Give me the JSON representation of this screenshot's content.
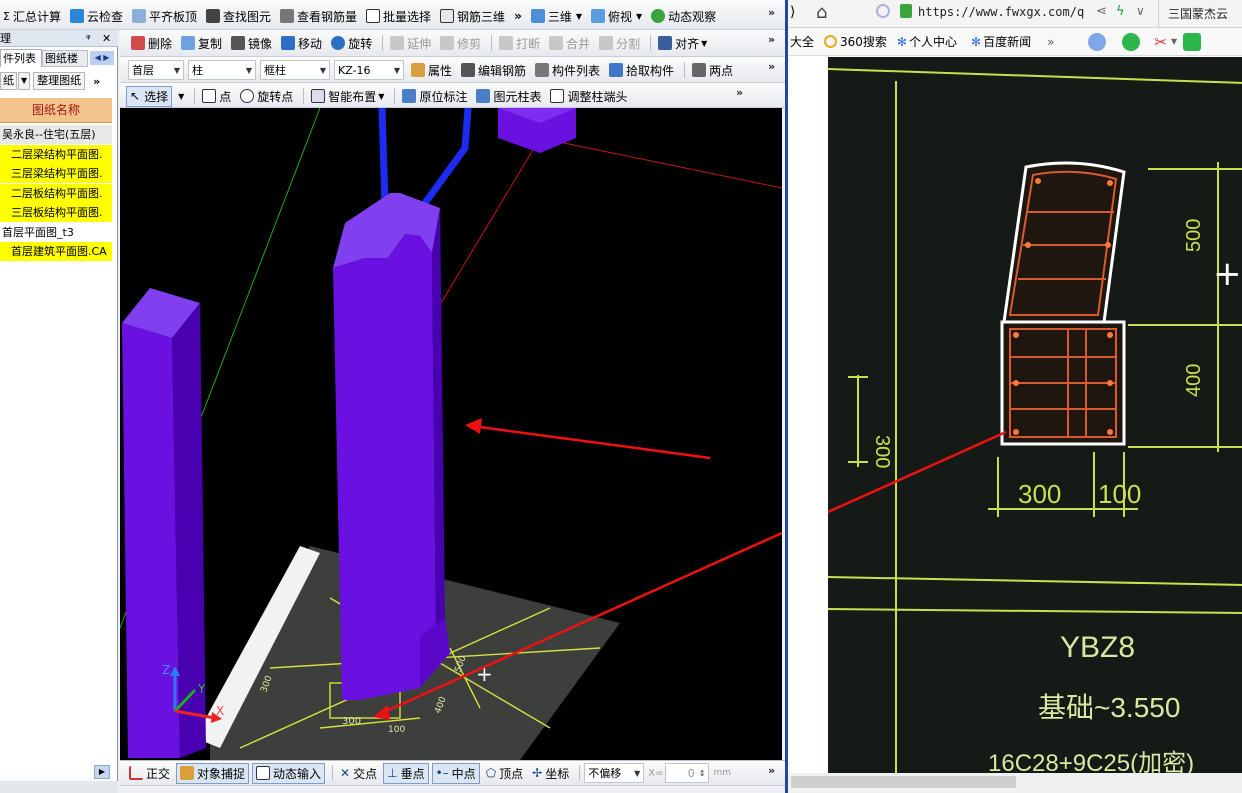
{
  "cad": {
    "toolbar1": {
      "items": [
        "汇总计算",
        "云检查",
        "平齐板顶",
        "查找图元",
        "查看钢筋量",
        "批量选择",
        "钢筋三维"
      ],
      "view3d": "三维",
      "view_top": "俯视",
      "dynamic": "动态观察"
    },
    "toolbar2": {
      "items": [
        "删除",
        "复制",
        "镜像",
        "移动",
        "旋转"
      ],
      "disabled": [
        "延伸",
        "修剪",
        "打断",
        "合并",
        "分割"
      ],
      "align": "对齐"
    },
    "toolbar3": {
      "floor": "首层",
      "category": "柱",
      "type": "框柱",
      "component": "KZ-16",
      "items": [
        "属性",
        "编辑钢筋",
        "构件列表",
        "拾取构件",
        "两点"
      ]
    },
    "toolbar4": {
      "select": "选择",
      "items": [
        "点",
        "旋转点",
        "智能布置",
        "原位标注",
        "图元柱表",
        "调整柱端头"
      ]
    },
    "left_panel": {
      "title_fragment": "理",
      "tabs": [
        "件列表",
        "图纸楼"
      ],
      "buttons": [
        "纸",
        "整理图纸"
      ],
      "header": "图纸名称",
      "rows": [
        {
          "text": "吴永良--住宅(五层)",
          "style": "group"
        },
        {
          "text": "二层梁结构平面图.",
          "style": "hl"
        },
        {
          "text": "三层梁结构平面图.",
          "style": "hl"
        },
        {
          "text": "二层板结构平面图.",
          "style": "hl"
        },
        {
          "text": "三层板结构平面图.",
          "style": "hl"
        },
        {
          "text": "首层平面图_t3",
          "style": "plain"
        },
        {
          "text": "首层建筑平面图.CA",
          "style": "hl"
        }
      ]
    },
    "axes": {
      "z": "Z",
      "y": "Y",
      "x": "X"
    },
    "plan_dims": {
      "d1": "300",
      "d2": "100",
      "d3": "500",
      "d4": "400",
      "d5": "300"
    },
    "statusbar": {
      "items": [
        "正交",
        "对象捕捉",
        "动态输入",
        "交点",
        "垂点",
        "中点",
        "顶点",
        "坐标"
      ],
      "offset": "不偏移",
      "x_label": "X=",
      "x_value": "0",
      "unit": "mm"
    }
  },
  "browser": {
    "url": "https://www.fwxgx.com/q",
    "tab_text": "三国蒙杰云",
    "bookmarks": [
      "大全",
      "360搜索",
      "个人中心",
      "百度新闻"
    ],
    "drawing": {
      "dim_500": "500",
      "dim_400": "400",
      "dim_300_side": "300",
      "dim_300": "300",
      "dim_100": "100",
      "name": "YBZ8",
      "elev": "基础~3.550",
      "rebar": "16C28+9C25(加密)"
    }
  },
  "colors": {
    "column": "#6a10e0",
    "column_dark": "#4800b0",
    "rebar": "#1c2cf0",
    "cad_line": "#d8e040",
    "arrow": "#ee1111",
    "highlight": "#ffff00"
  }
}
